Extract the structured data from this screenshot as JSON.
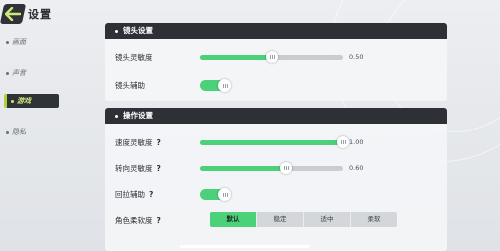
{
  "header": {
    "title": "设置"
  },
  "sidebar": {
    "items": [
      {
        "label": "画面",
        "active": false
      },
      {
        "label": "声音",
        "active": false
      },
      {
        "label": "游戏",
        "active": true
      },
      {
        "label": "隐私",
        "active": false
      }
    ]
  },
  "camera_panel": {
    "title": "镜头设置",
    "sensitivity": {
      "label": "镜头灵敏度",
      "value": 0.5,
      "value_text": "0.50"
    },
    "assist": {
      "label": "镜头辅助",
      "on": true
    }
  },
  "control_panel": {
    "title": "操作设置",
    "speed": {
      "label": "速度灵敏度",
      "help": "?",
      "value": 1.0,
      "value_text": "1.00"
    },
    "steer": {
      "label": "转向灵敏度",
      "help": "?",
      "value": 0.6,
      "value_text": "0.60"
    },
    "pullback": {
      "label": "回拉辅助",
      "help": "?",
      "on": true
    },
    "softness": {
      "label": "角色柔软度",
      "help": "?",
      "options": [
        "默认",
        "稳定",
        "适中",
        "柔软"
      ],
      "selected": 0
    }
  },
  "colors": {
    "accent": "#4cd07a",
    "dark": "#2d3035",
    "active_tab_text": "#cfe87a"
  },
  "icons": {
    "back": "back-arrow-icon",
    "help": "question-icon"
  }
}
